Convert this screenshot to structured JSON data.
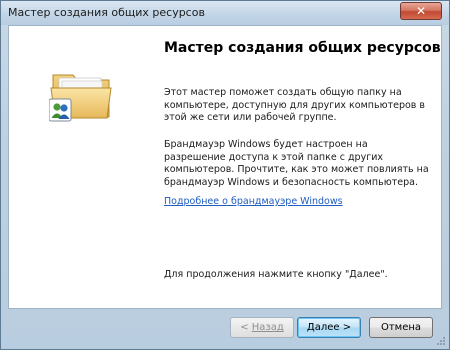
{
  "window": {
    "title": "Мастер создания общих ресурсов",
    "close_glyph": "✕"
  },
  "icon": {
    "name": "shared-folder-icon"
  },
  "content": {
    "heading": "Мастер создания общих ресурсов",
    "paragraph1": "Этот мастер поможет создать общую папку на компьютере, доступную для других компьютеров в этой же сети или рабочей группе.",
    "paragraph2": "Брандмауэр Windows будет настроен на разрешение доступа к этой папке с других компьютеров. Прочтите, как это может повлиять на брандмауэр Windows и безопасность компьютера.",
    "firewall_link": "Подробнее о брандмауэре Windows",
    "continue_text": "Для продолжения нажмите кнопку \"Далее\"."
  },
  "buttons": {
    "back_arrow": "< ",
    "back_label": "Назад",
    "next_label": "Далее >",
    "cancel_label": "Отмена"
  },
  "colors": {
    "link": "#1f5dbf",
    "default_button_border": "#3c7fb1",
    "close_button": "#c14a33"
  }
}
